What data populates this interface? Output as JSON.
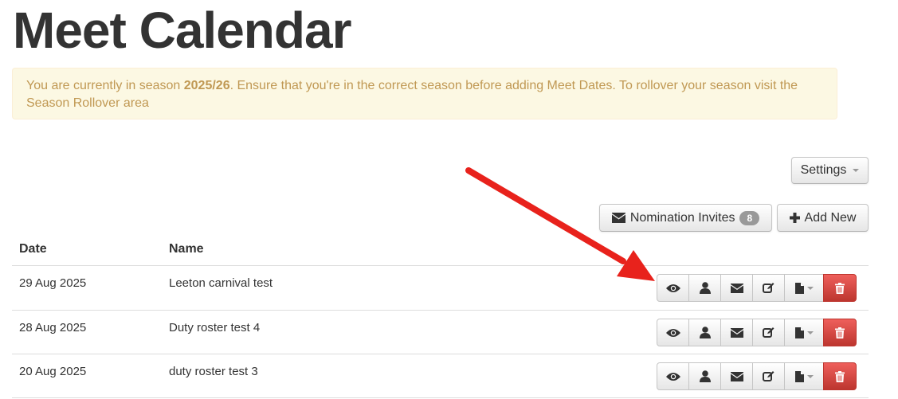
{
  "page": {
    "title": "Meet Calendar"
  },
  "alert": {
    "prefix": "You are currently in season ",
    "season": "2025/26",
    "suffix": ". Ensure that you're in the correct season before adding Meet Dates. To rollover your season visit the Season Rollover area"
  },
  "toolbar": {
    "settings_label": "Settings",
    "nomination_label": "Nomination Invites",
    "nomination_count": "8",
    "add_new_label": "Add New"
  },
  "table": {
    "columns": [
      "Date",
      "Name"
    ],
    "rows": [
      {
        "date": "29 Aug 2025",
        "name": "Leeton carnival test"
      },
      {
        "date": "28 Aug 2025",
        "name": "Duty roster test 4"
      },
      {
        "date": "20 Aug 2025",
        "name": "duty roster test 3"
      }
    ]
  },
  "row_actions": [
    "eye-icon",
    "user-icon",
    "envelope-icon",
    "edit-icon",
    "file-icon",
    "trash-icon"
  ],
  "colors": {
    "alert_bg": "#fcf8e3",
    "alert_text": "#c09853",
    "danger": "#da4f49",
    "annotation_arrow": "#e8221c"
  }
}
